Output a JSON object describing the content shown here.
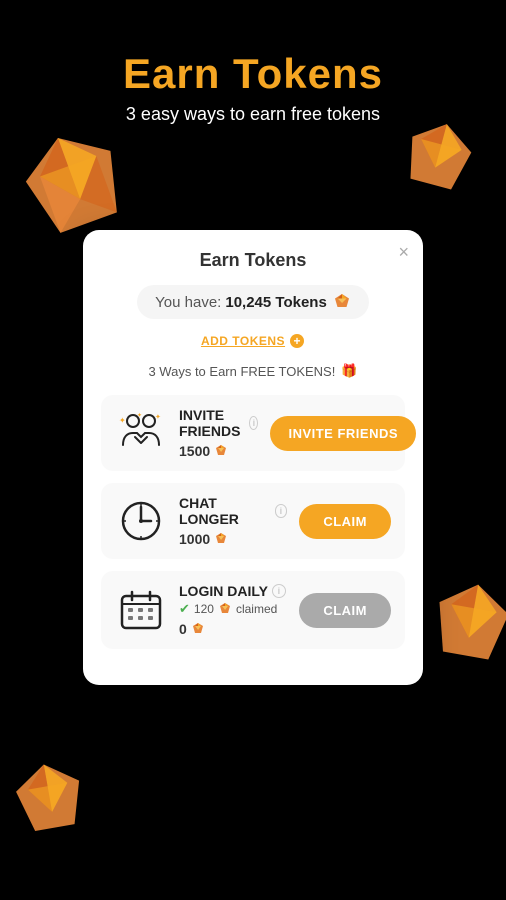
{
  "page": {
    "background": "#000000"
  },
  "header": {
    "title": "Earn Tokens",
    "subtitle": "3 easy ways to earn free tokens"
  },
  "modal": {
    "title": "Earn Tokens",
    "close_label": "×",
    "you_have_label": "You have:",
    "token_count": "10,245 Tokens",
    "add_tokens_label": "ADD TOKENS",
    "ways_label": "3 Ways to Earn FREE TOKENS!",
    "earn_items": [
      {
        "id": "invite",
        "name": "INVITE FRIENDS",
        "tokens": "1500",
        "action_label": "INVITE FRIENDS",
        "action_type": "invite"
      },
      {
        "id": "chat",
        "name": "CHAT LONGER",
        "tokens": "1000",
        "action_label": "CLAIM",
        "action_type": "claim"
      },
      {
        "id": "login",
        "name": "LOGIN DAILY",
        "tokens": "0",
        "claimed_amount": "120",
        "claimed_label": "claimed",
        "action_label": "CLAIM",
        "action_type": "claim_gray"
      }
    ]
  }
}
